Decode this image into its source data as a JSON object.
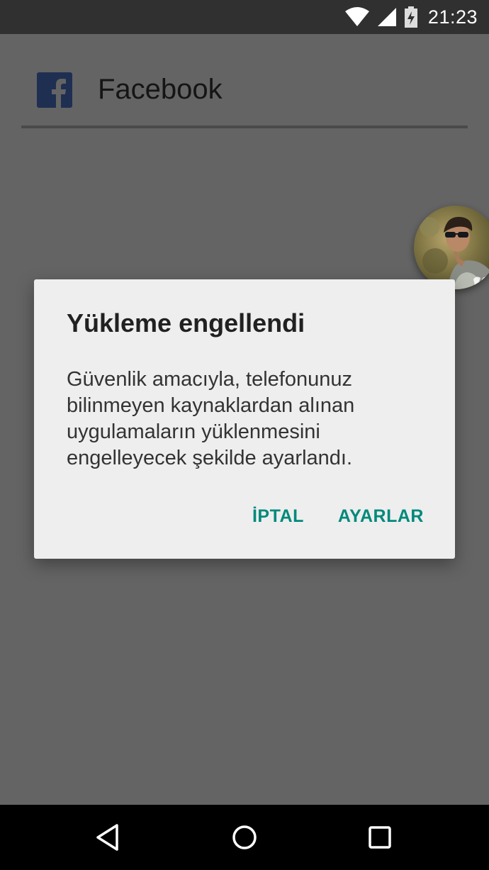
{
  "status_bar": {
    "time": "21:23",
    "icons": [
      "wifi-icon",
      "signal-icon",
      "battery-charging-icon"
    ]
  },
  "app": {
    "title": "Facebook",
    "icon": "facebook-logo"
  },
  "dialog": {
    "title": "Yükleme engellendi",
    "message": "Güvenlik amacıyla, telefonunuz bilinmeyen kaynaklardan alınan uygulamaların yüklenmesini engelleyecek şekilde ayarlandı.",
    "cancel_label": "İPTAL",
    "settings_label": "AYARLAR"
  },
  "chat_head": {
    "icon": "avatar"
  },
  "nav_bar": {
    "buttons": [
      "back-icon",
      "home-icon",
      "recents-icon"
    ]
  },
  "colors": {
    "accent": "#00897b",
    "scrim": "#646464",
    "dialog_bg": "#eeeeee",
    "facebook_blue": "#1e2f51"
  }
}
